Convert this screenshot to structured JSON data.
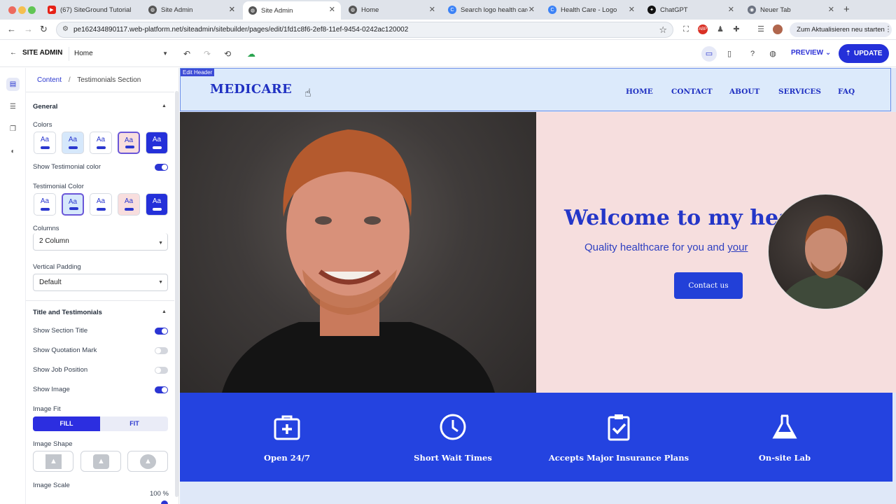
{
  "browser": {
    "tabs": [
      {
        "label": "(67) SiteGround Tutorial",
        "favicon": "youtube-icon"
      },
      {
        "label": "Site Admin",
        "favicon": "globe-icon"
      },
      {
        "label": "Site Admin",
        "favicon": "globe-icon",
        "active": true
      },
      {
        "label": "Home",
        "favicon": "globe-icon"
      },
      {
        "label": "Search logo health care",
        "favicon": "canva-icon"
      },
      {
        "label": "Health Care - Logo",
        "favicon": "canva-icon"
      },
      {
        "label": "ChatGPT",
        "favicon": "chatgpt-icon"
      },
      {
        "label": "Neuer Tab",
        "favicon": "chrome-icon"
      }
    ],
    "url": "pe162434890117.web-platform.net/siteadmin/sitebuilder/pages/edit/1fd1c8f6-2ef8-11ef-9454-0242ac120002",
    "update_chip": "Zum Aktualisieren neu starten"
  },
  "appbar": {
    "site_admin_label": "SITE ADMIN",
    "page_select": "Home",
    "preview_label": "PREVIEW",
    "update_label": "UPDATE"
  },
  "panel": {
    "breadcrumb": {
      "root": "Content",
      "current": "Testimonials Section"
    },
    "general": {
      "title": "General",
      "colors_label": "Colors",
      "swatch_text": "Aa",
      "show_testimonial_color_label": "Show Testimonial color",
      "show_testimonial_color": true,
      "testimonial_color_label": "Testimonial Color",
      "columns_label": "Columns",
      "columns_value": "2 Column",
      "vertical_padding_label": "Vertical Padding",
      "vertical_padding_value": "Default"
    },
    "title_testimonials": {
      "title": "Title and Testimonials",
      "toggles": [
        {
          "label": "Show Section Title",
          "on": true
        },
        {
          "label": "Show Quotation Mark",
          "on": false
        },
        {
          "label": "Show Job Position",
          "on": false
        },
        {
          "label": "Show Image",
          "on": true
        }
      ],
      "image_fit_label": "Image Fit",
      "image_fit_options": [
        "FILL",
        "FIT"
      ],
      "image_fit_selected": "FILL",
      "image_shape_label": "Image Shape",
      "image_scale_label": "Image Scale",
      "image_scale_value": "100 %"
    }
  },
  "site": {
    "edit_tag": "Edit Header",
    "logo": "MEDICARE",
    "nav": [
      "HOME",
      "CONTACT",
      "ABOUT",
      "SERVICES",
      "FAQ"
    ],
    "hero_title": "Welcome to my heal",
    "hero_subtitle_a": "Quality healthcare for you and ",
    "hero_subtitle_b": "your",
    "hero_button": "Contact us",
    "features": [
      {
        "label": "Open 24/7",
        "icon": "medical-kit-icon"
      },
      {
        "label": "Short Wait Times",
        "icon": "clock-icon"
      },
      {
        "label": "Accepts Major Insurance Plans",
        "icon": "clipboard-check-icon"
      },
      {
        "label": "On-site Lab",
        "icon": "flask-icon"
      }
    ]
  },
  "colors": {
    "accent": "#2430d9",
    "site_blue": "#2443e0",
    "hero_bg": "#f6dede",
    "header_bg": "#dceafb"
  }
}
